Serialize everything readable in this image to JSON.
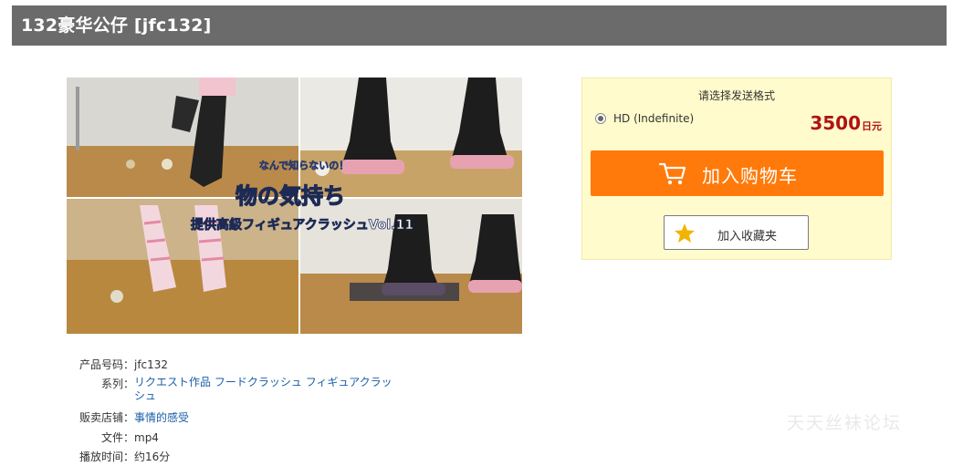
{
  "page": {
    "title": "132豪华公仔 [jfc132]"
  },
  "product_image": {
    "overlay_small": "なんで知らないの！",
    "overlay_title": "物の気持ち",
    "overlay_subtitle": "提供高級フィギュアクラッシュVol.11"
  },
  "info": {
    "product_code_label": "产品号码：",
    "product_code": "jfc132",
    "series_label": "系列：",
    "series_links": [
      "リクエスト作品",
      "フードクラッシュ",
      "フィギュアクラッシュ"
    ],
    "shop_label": "贩卖店铺：",
    "shop": "事情的感受",
    "file_label": "文件：",
    "file": "mp4",
    "duration_label": "播放时间：",
    "duration": "约16分"
  },
  "purchase": {
    "choose_format": "请选择发送格式",
    "format_option": "HD (Indefinite)",
    "price": "3500",
    "price_unit": "日元",
    "add_to_cart": "加入购物车",
    "add_to_favorites": "加入收藏夹"
  },
  "watermark": "天天丝袜论坛",
  "colors": {
    "title_bar": "#6b6b6b",
    "cart_button": "#ff7a0a",
    "panel_bg": "#fffbcc",
    "price": "#b11212",
    "link": "#1a5fa8",
    "star": "#f2b400"
  },
  "icons": [
    "cart-icon",
    "star-icon",
    "radio-icon"
  ]
}
